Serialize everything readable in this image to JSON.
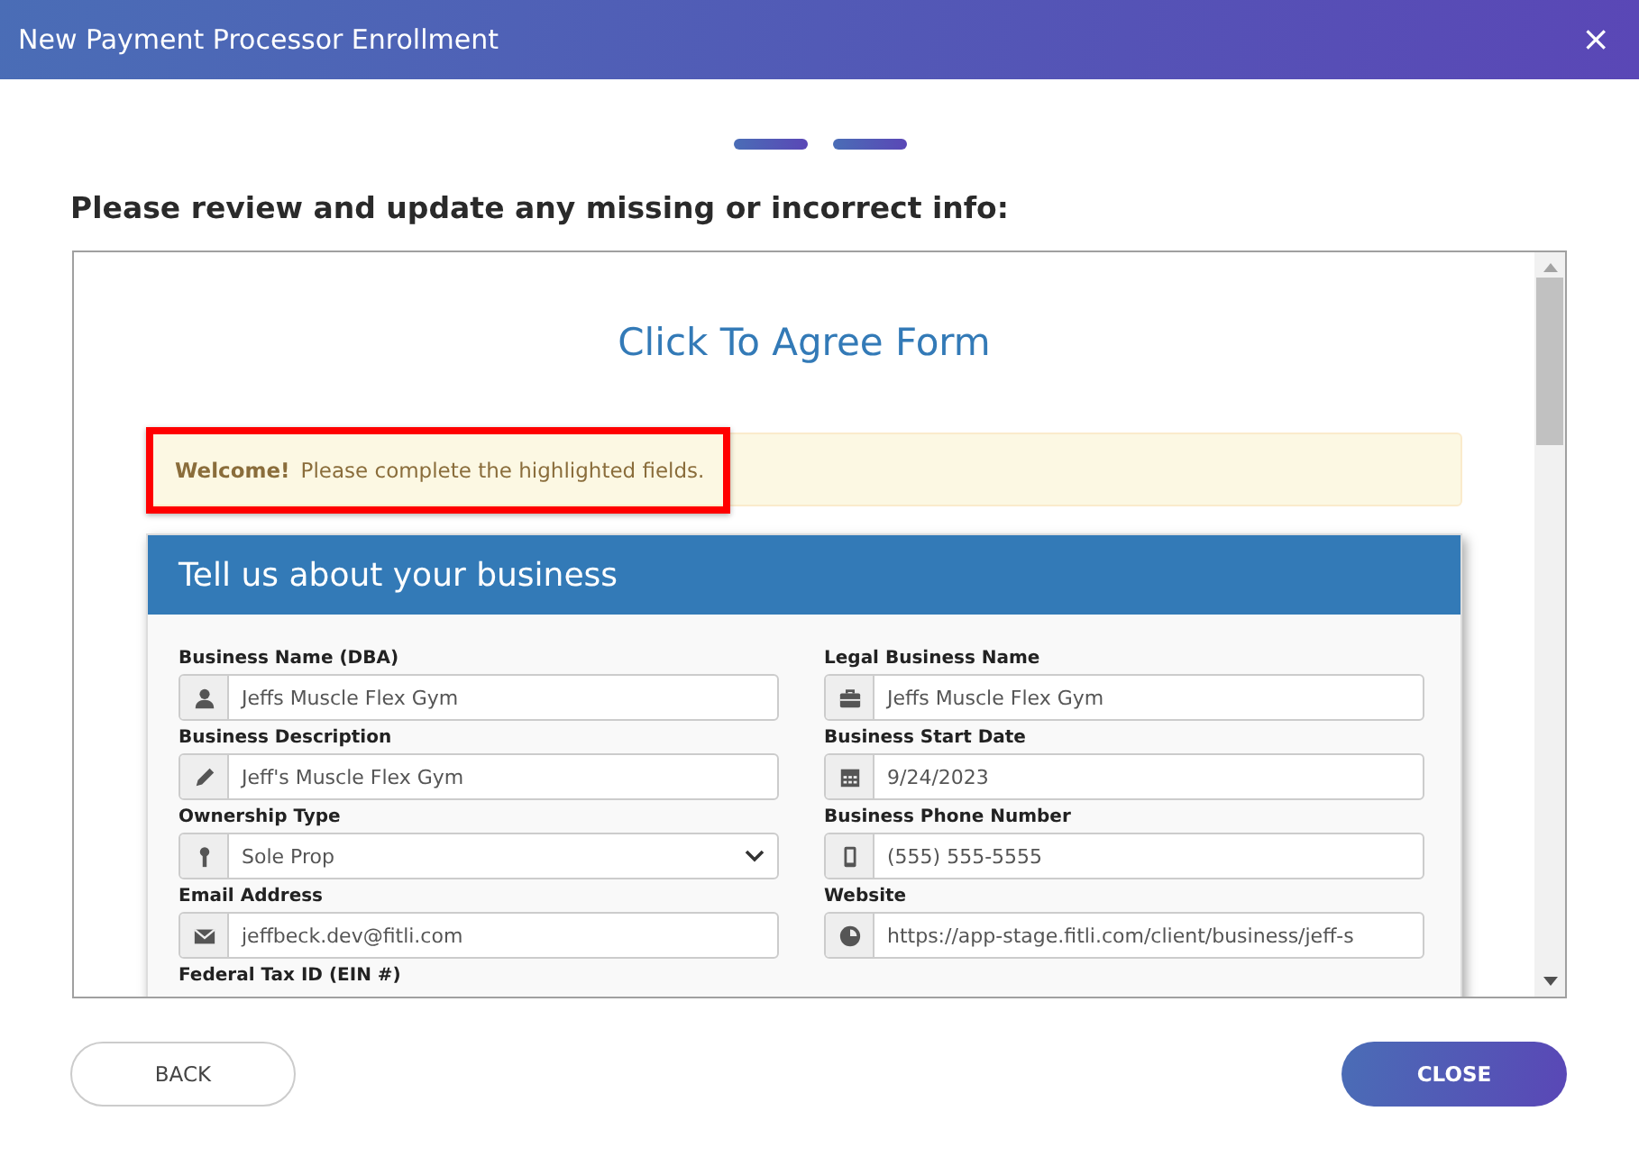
{
  "window": {
    "title": "New Payment Processor Enrollment",
    "close": "×"
  },
  "steps": [
    {
      "selected": true
    },
    {
      "selected": true
    }
  ],
  "heading": "Please review and update any missing or incorrect info:",
  "form": {
    "title": "Click To Agree Form",
    "alert": {
      "strong": "Welcome!",
      "text": "Please complete the highlighted fields.",
      "highlighted": true
    },
    "section_title": "Tell us about your business",
    "fields": [
      {
        "label": "Business Name (DBA)",
        "kind": "input",
        "value": "Jeffs Muscle Flex Gym"
      },
      {
        "label": "Legal Business Name",
        "kind": "input",
        "value": "Jeffs Muscle Flex Gym"
      },
      {
        "label": "Business Description",
        "kind": "input",
        "value": "Jeff's Muscle Flex Gym"
      },
      {
        "label": "Business Start Date",
        "kind": "input",
        "value": "9/24/2023"
      },
      {
        "label": "Ownership Type",
        "kind": "select",
        "value": "Sole Prop"
      },
      {
        "label": "Business Phone Number",
        "kind": "input",
        "value": "(555) 555-5555"
      },
      {
        "label": "Email Address",
        "kind": "input",
        "value": "jeffbeck.dev@fitli.com"
      },
      {
        "label": "Website",
        "kind": "input",
        "value": "https://app-stage.fitli.com/client/business/jeff-s"
      },
      {
        "label": "Federal Tax ID (EIN #)",
        "kind": "label"
      }
    ]
  },
  "buttons": [
    {
      "label": "BACK",
      "kind": "secondary"
    },
    {
      "label": "CLOSE",
      "kind": "primary"
    }
  ]
}
